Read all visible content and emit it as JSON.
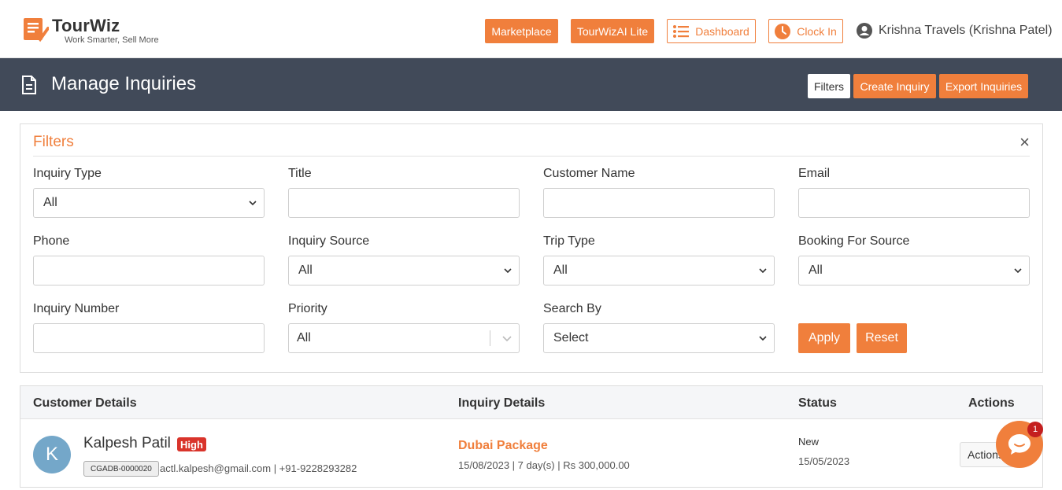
{
  "brand": {
    "name": "TourWiz",
    "tagline": "Work Smarter, Sell More",
    "accent": "#f07f3c"
  },
  "topnav": {
    "marketplace": "Marketplace",
    "lite": "TourWizAI Lite",
    "dashboard": "Dashboard",
    "clock_in": "Clock In",
    "user": "Krishna Travels (Krishna Patel)"
  },
  "page": {
    "title": "Manage Inquiries",
    "filters_btn": "Filters",
    "create_btn": "Create Inquiry",
    "export_btn": "Export Inquiries"
  },
  "filters": {
    "title": "Filters",
    "close": "×",
    "inquiry_type": {
      "label": "Inquiry Type",
      "value": "All"
    },
    "title_field": {
      "label": "Title",
      "value": ""
    },
    "customer_name": {
      "label": "Customer Name",
      "value": ""
    },
    "email": {
      "label": "Email",
      "value": ""
    },
    "phone": {
      "label": "Phone",
      "value": ""
    },
    "inquiry_source": {
      "label": "Inquiry Source",
      "value": "All"
    },
    "trip_type": {
      "label": "Trip Type",
      "value": "All"
    },
    "booking_for_source": {
      "label": "Booking For Source",
      "value": "All"
    },
    "inquiry_number": {
      "label": "Inquiry Number",
      "value": ""
    },
    "priority": {
      "label": "Priority",
      "value": "All"
    },
    "search_by": {
      "label": "Search By",
      "value": "Select"
    },
    "apply": "Apply",
    "reset": "Reset"
  },
  "table": {
    "columns": [
      "Customer Details",
      "Inquiry Details",
      "Status",
      "Actions"
    ],
    "rows": [
      {
        "initial": "K",
        "name": "Kalpesh Patil",
        "priority": "High",
        "code": "CGADB-0000020",
        "contact": "actl.kalpesh@gmail.com | +91-9228293282",
        "inquiry_title": "Dubai Package",
        "inquiry_meta": "15/08/2023 | 7 day(s) | Rs 300,000.00",
        "status": "New",
        "status_date": "15/05/2023",
        "actions": "Actions"
      }
    ]
  },
  "chat": {
    "badge": "1"
  },
  "icons": [
    "logo-icon",
    "list-icon",
    "clock-icon",
    "user-icon",
    "document-icon",
    "chevron-down-icon",
    "chat-icon"
  ]
}
